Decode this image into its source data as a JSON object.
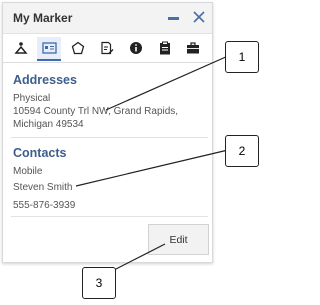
{
  "window": {
    "title": "My Marker"
  },
  "tabs": [
    {
      "icon": "hiker-icon"
    },
    {
      "icon": "contact-card-icon"
    },
    {
      "icon": "polygon-icon"
    },
    {
      "icon": "edit-document-icon"
    },
    {
      "icon": "info-icon"
    },
    {
      "icon": "clipboard-icon"
    },
    {
      "icon": "briefcase-icon"
    }
  ],
  "addresses": {
    "title": "Addresses",
    "type": "Physical",
    "line1": "10594 County Trl NW, Grand Rapids,",
    "line2": "Michigan 49534"
  },
  "contacts": {
    "title": "Contacts",
    "type": "Mobile",
    "name": "Steven Smith",
    "phone": "555-876-3939"
  },
  "actions": {
    "edit_label": "Edit"
  },
  "callouts": {
    "c1": "1",
    "c2": "2",
    "c3": "3"
  },
  "colors": {
    "accent": "#3e5e8e",
    "icon": "#222222"
  }
}
